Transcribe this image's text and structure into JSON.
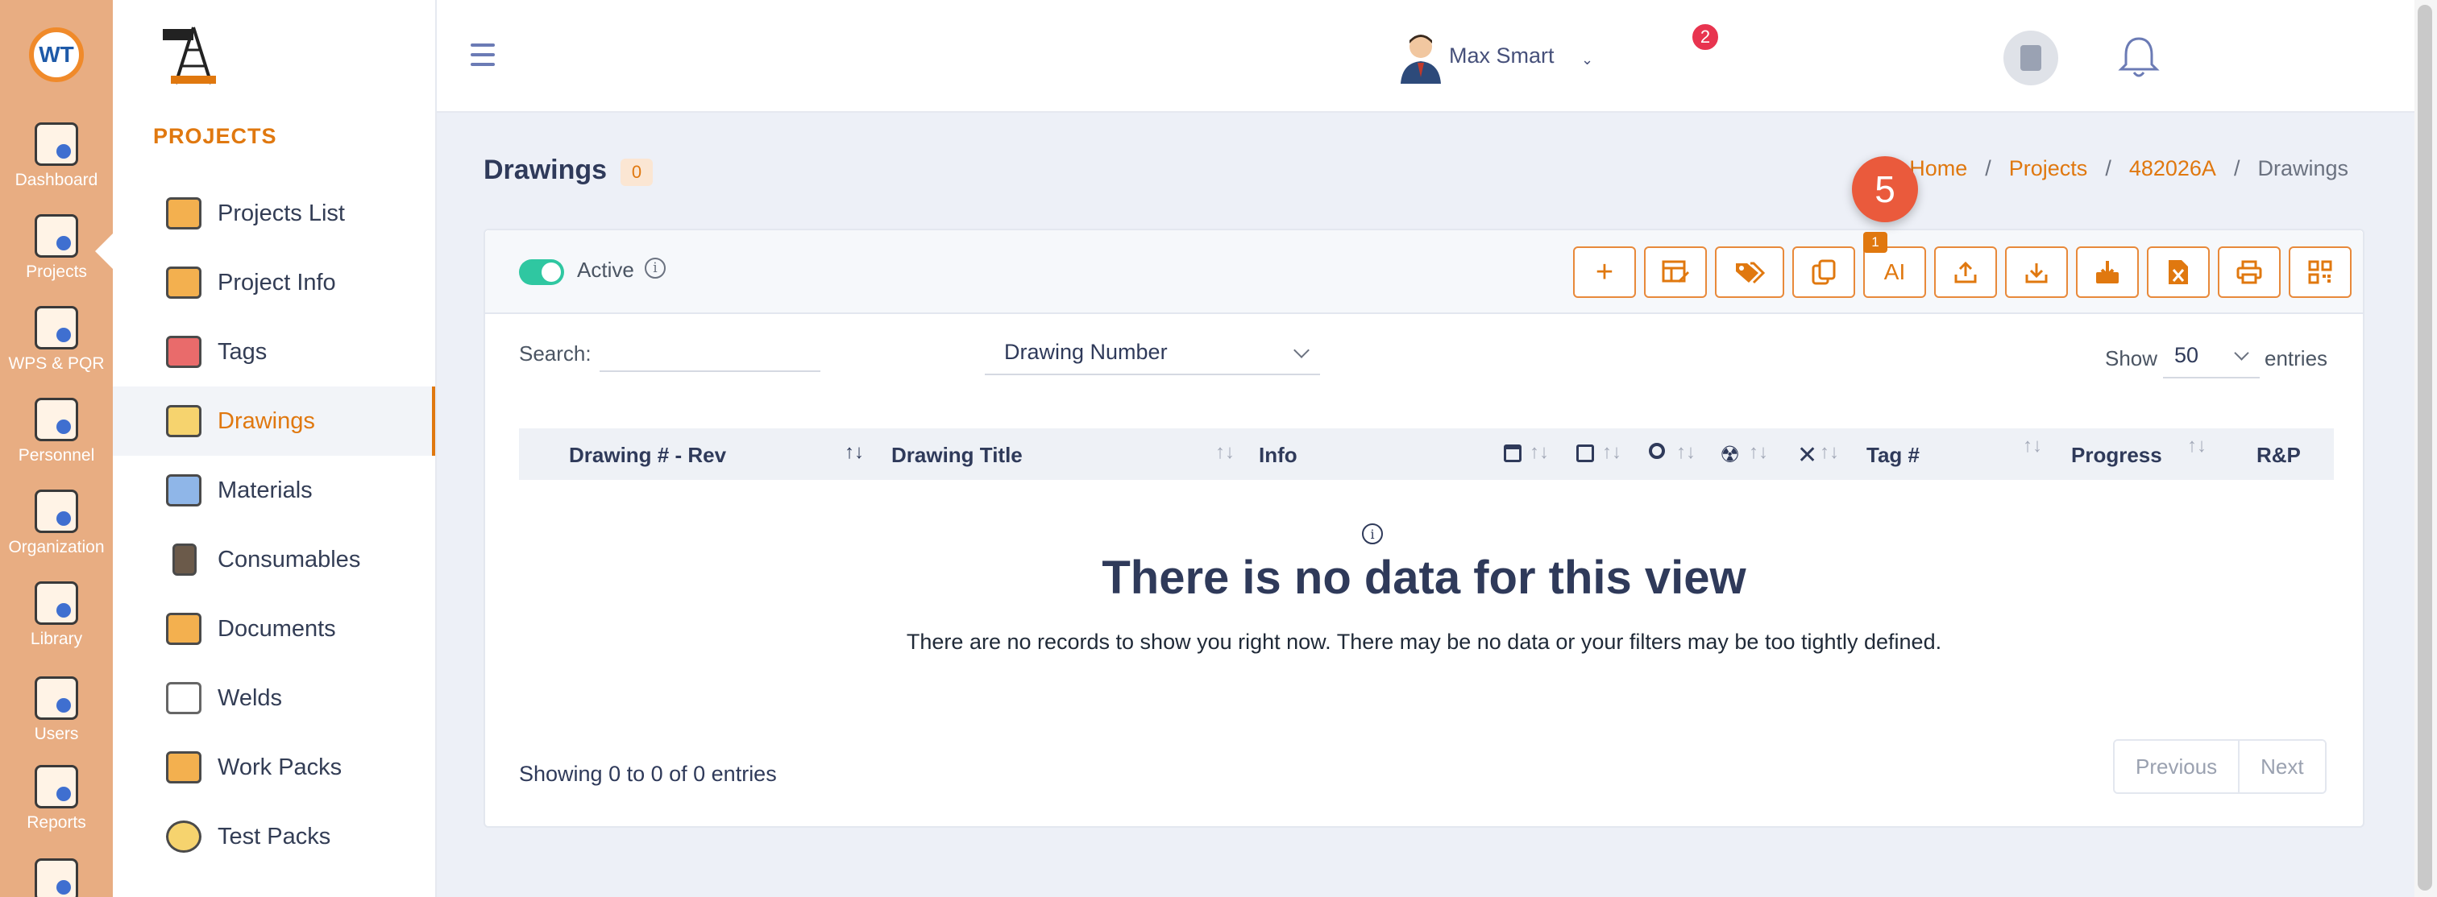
{
  "rail": {
    "logo_text": "WT",
    "items": [
      {
        "label": "Dashboard",
        "icon": "dashboard-icon"
      },
      {
        "label": "Projects",
        "icon": "projects-icon"
      },
      {
        "label": "WPS & PQR",
        "icon": "wps-pqr-icon"
      },
      {
        "label": "Personnel",
        "icon": "welder-icon"
      },
      {
        "label": "Organization",
        "icon": "organization-icon"
      },
      {
        "label": "Library",
        "icon": "library-icon"
      },
      {
        "label": "Users",
        "icon": "users-icon"
      },
      {
        "label": "Reports",
        "icon": "reports-icon"
      }
    ]
  },
  "sidebar": {
    "section": "PROJECTS",
    "items": [
      {
        "label": "Projects List",
        "icon": "folder-icon"
      },
      {
        "label": "Project Info",
        "icon": "gears-icon"
      },
      {
        "label": "Tags",
        "icon": "tag-icon"
      },
      {
        "label": "Drawings",
        "icon": "drawing-icon",
        "active": true
      },
      {
        "label": "Materials",
        "icon": "pipes-icon"
      },
      {
        "label": "Consumables",
        "icon": "spool-icon"
      },
      {
        "label": "Documents",
        "icon": "documents-icon"
      },
      {
        "label": "Welds",
        "icon": "weld-icon"
      },
      {
        "label": "Work Packs",
        "icon": "work-pack-icon"
      },
      {
        "label": "Test Packs",
        "icon": "radiation-icon"
      }
    ]
  },
  "header": {
    "notification_count": "2",
    "user_name": "Max Smart"
  },
  "page": {
    "title": "Drawings",
    "count": "0",
    "breadcrumbs": [
      "Home",
      "Projects",
      "482026A",
      "Drawings"
    ],
    "step_number": "5"
  },
  "toolbar": {
    "active_label": "Active",
    "ai_label": "AI",
    "ai_badge": "1",
    "buttons": [
      "add-icon",
      "table-edit-icon",
      "tags-icon",
      "copy-icon",
      "ai-icon",
      "upload-icon",
      "download-icon",
      "import-icon",
      "excel-icon",
      "print-icon",
      "qr-code-icon"
    ]
  },
  "filters": {
    "search_label": "Search:",
    "search_value": "",
    "field_selected": "Drawing Number",
    "show_label": "Show",
    "page_size": "50",
    "entries_label": "entries"
  },
  "table": {
    "columns": [
      "Drawing # - Rev",
      "Drawing Title",
      "Info",
      "Tag #",
      "Progress",
      "R&P"
    ]
  },
  "empty": {
    "title": "There is no data for this view",
    "message": "There are no records to show you right now. There may be no data or your filters may be too tightly defined."
  },
  "footer": {
    "showing": "Showing 0 to 0 of 0 entries",
    "previous": "Previous",
    "next": "Next"
  },
  "colors": {
    "accent": "#e0780f",
    "rail_bg": "#e8ad82",
    "toggle_on": "#2fc7a1",
    "badge_red": "#e8344f",
    "step_callout": "#ea5a3c"
  }
}
